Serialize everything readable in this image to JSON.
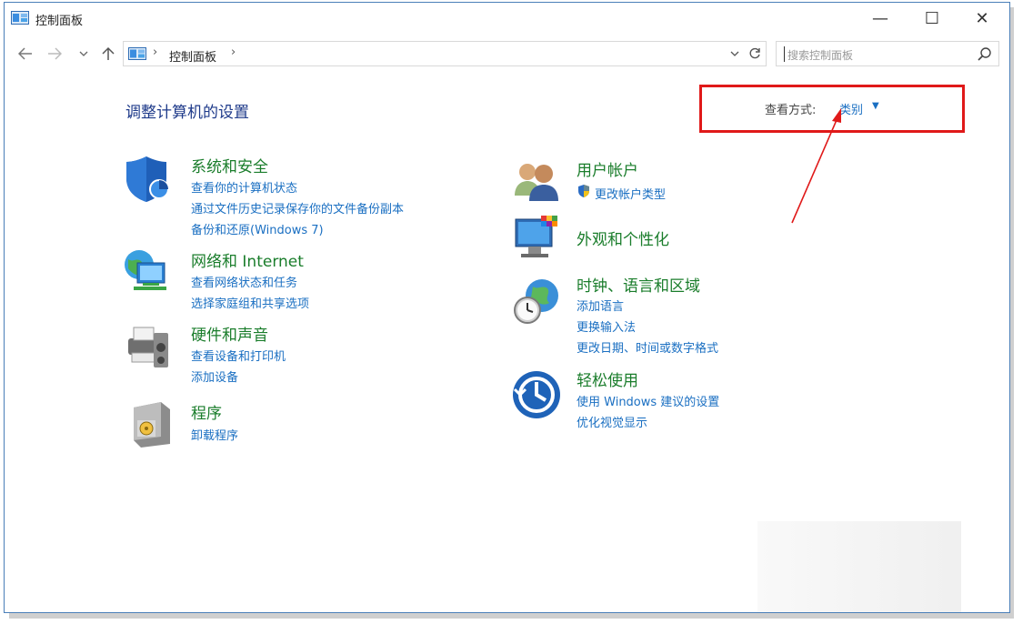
{
  "window": {
    "title": "控制面板",
    "controls": {
      "minimize": "—",
      "maximize": "☐",
      "close": "✕"
    }
  },
  "address_bar": {
    "breadcrumb": "控制面板",
    "separator": "›",
    "search_placeholder": "搜索控制面板"
  },
  "main": {
    "heading": "调整计算机的设置",
    "view_by": {
      "label": "查看方式:",
      "value": "类别"
    }
  },
  "categories_left": [
    {
      "title": "系统和安全",
      "links": [
        "查看你的计算机状态",
        "通过文件历史记录保存你的文件备份副本",
        "备份和还原(Windows 7)"
      ],
      "icon": "shield-icon"
    },
    {
      "title": "网络和 Internet",
      "links": [
        "查看网络状态和任务",
        "选择家庭组和共享选项"
      ],
      "icon": "network-globe-icon"
    },
    {
      "title": "硬件和声音",
      "links": [
        "查看设备和打印机",
        "添加设备"
      ],
      "icon": "printer-speaker-icon"
    },
    {
      "title": "程序",
      "links": [
        "卸载程序"
      ],
      "icon": "programs-box-icon"
    }
  ],
  "categories_right": [
    {
      "title": "用户帐户",
      "links": [
        "更改帐户类型"
      ],
      "icon": "users-icon"
    },
    {
      "title": "外观和个性化",
      "links": [],
      "icon": "monitor-palette-icon"
    },
    {
      "title": "时钟、语言和区域",
      "links": [
        "添加语言",
        "更换输入法",
        "更改日期、时间或数字格式"
      ],
      "icon": "clock-globe-icon"
    },
    {
      "title": "轻松使用",
      "links": [
        "使用 Windows 建议的设置",
        "优化视觉显示"
      ],
      "icon": "ease-of-access-icon"
    }
  ],
  "colors": {
    "category_title": "#1a7d2b",
    "link": "#1a6fc2",
    "heading": "#1e3a8a",
    "highlight_box": "#e01919"
  }
}
